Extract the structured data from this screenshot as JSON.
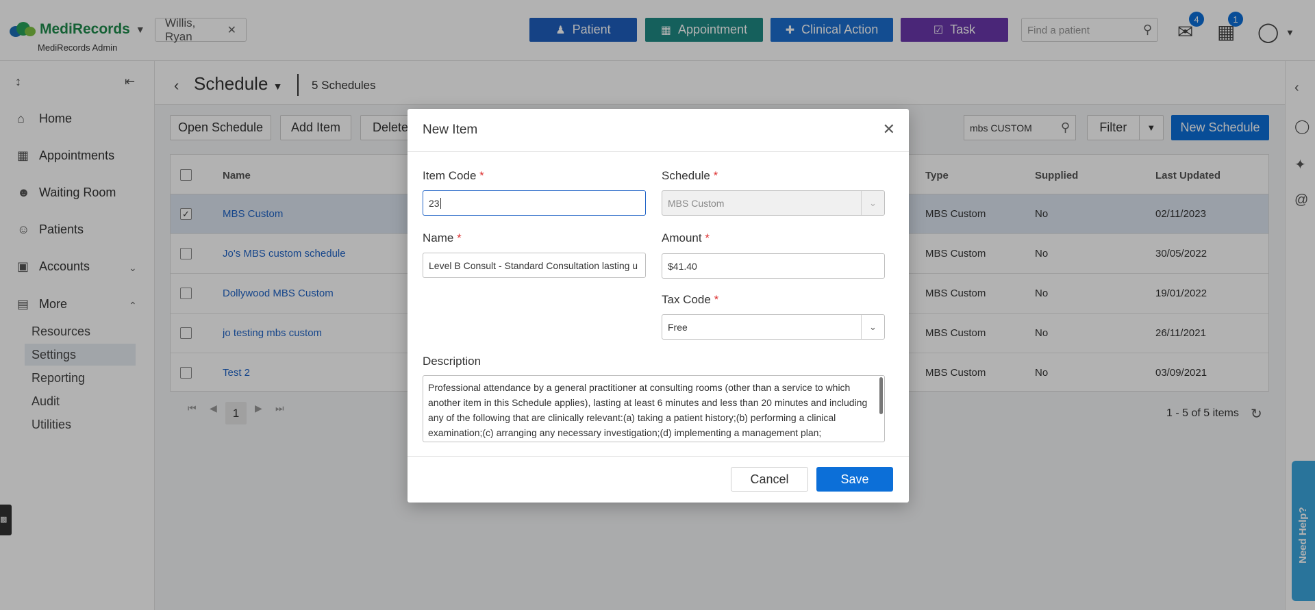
{
  "app": {
    "brand_name": "MediRecords",
    "brand_sub": "MediRecords Admin",
    "active_patient": "Willis, Ryan",
    "colors": {
      "patient": "#1f5fbf",
      "appointment": "#1f8a84",
      "clinical": "#1c6fd0",
      "task": "#6b37ad",
      "primary": "#0c6fd8"
    }
  },
  "top_actions": [
    {
      "label": "Patient",
      "icon": "add-person-icon"
    },
    {
      "label": "Appointment",
      "icon": "calendar-icon"
    },
    {
      "label": "Clinical Action",
      "icon": "medical-kit-icon"
    },
    {
      "label": "Task",
      "icon": "clipboard-icon"
    }
  ],
  "search_patient": {
    "placeholder": "Find a patient"
  },
  "notifications": {
    "mail_count": "4",
    "tasks_count": "1"
  },
  "sidebar": {
    "items": [
      {
        "label": "Home",
        "icon": "home-icon"
      },
      {
        "label": "Appointments",
        "icon": "calendar-icon"
      },
      {
        "label": "Waiting Room",
        "icon": "people-icon"
      },
      {
        "label": "Patients",
        "icon": "patients-icon"
      },
      {
        "label": "Accounts",
        "icon": "folder-icon"
      },
      {
        "label": "More",
        "icon": "folder-open-icon"
      }
    ],
    "sub_items": [
      "Resources",
      "Settings",
      "Reporting",
      "Audit",
      "Utilities"
    ]
  },
  "page": {
    "title": "Schedule",
    "count_label": "5 Schedules",
    "toolbar": {
      "open": "Open Schedule",
      "add": "Add Item",
      "delete": "Delete",
      "filter": "Filter",
      "new": "New Schedule"
    },
    "grid_search_value": "mbs CUSTOM"
  },
  "grid": {
    "columns": [
      "Name",
      "Type",
      "Supplied",
      "Last Updated"
    ],
    "rows": [
      {
        "name": "MBS Custom",
        "type": "MBS Custom",
        "supplied": "No",
        "updated": "02/11/2023",
        "selected": true
      },
      {
        "name": "Jo's MBS custom schedule",
        "type": "MBS Custom",
        "supplied": "No",
        "updated": "30/05/2022",
        "selected": false
      },
      {
        "name": "Dollywood MBS Custom",
        "type": "MBS Custom",
        "supplied": "No",
        "updated": "19/01/2022",
        "selected": false
      },
      {
        "name": "jo testing mbs custom",
        "type": "MBS Custom",
        "supplied": "No",
        "updated": "26/11/2021",
        "selected": false
      },
      {
        "name": "Test 2",
        "type": "MBS Custom",
        "supplied": "No",
        "updated": "03/09/2021",
        "selected": false
      }
    ],
    "pager_page": "1",
    "items_label": "1 - 5 of 5 items"
  },
  "help": {
    "label": "Need Help?"
  },
  "modal": {
    "title": "New Item",
    "item_code_label": "Item Code",
    "item_code_value": "23",
    "schedule_label": "Schedule",
    "schedule_value": "MBS Custom",
    "name_label": "Name",
    "name_value": "Level B Consult - Standard Consultation lasting u",
    "amount_label": "Amount",
    "amount_value": "$41.40",
    "tax_label": "Tax Code",
    "tax_value": "Free",
    "description_label": "Description",
    "description_value": "Professional attendance by a general practitioner at consulting rooms (other than a service to which another item in this Schedule applies), lasting at least 6 minutes and less than 20 minutes and including any of the following that are clinically relevant:(a) taking a patient history;(b) performing a clinical examination;(c) arranging any necessary investigation;(d) implementing a management plan;",
    "cancel": "Cancel",
    "save": "Save",
    "required_marker": "*"
  }
}
